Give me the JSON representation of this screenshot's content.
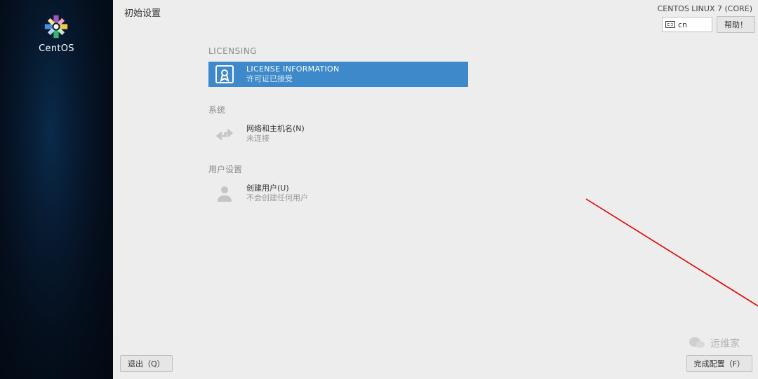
{
  "sidebar": {
    "brand": "CentOS"
  },
  "header": {
    "title": "初始设置",
    "distro": "CENTOS LINUX 7 (CORE)",
    "keyboard_layout": "cn",
    "help_label": "帮助！"
  },
  "sections": {
    "licensing": {
      "heading": "LICENSING",
      "license": {
        "title": "LICENSE INFORMATION",
        "status": "许可证已接受"
      }
    },
    "system": {
      "heading": "系统",
      "network": {
        "title": "网络和主机名(N)",
        "status": "未连接"
      }
    },
    "users": {
      "heading": "用户设置",
      "create_user": {
        "title": "创建用户(U)",
        "status": "不会创建任何用户"
      }
    }
  },
  "footer": {
    "quit_label": "退出（Q）",
    "finish_label": "完成配置（F）"
  },
  "watermark": {
    "text": "运维家"
  },
  "colors": {
    "selected_bg": "#3d89c9",
    "page_bg": "#ededee",
    "sidebar_bg": "#050e1c"
  }
}
